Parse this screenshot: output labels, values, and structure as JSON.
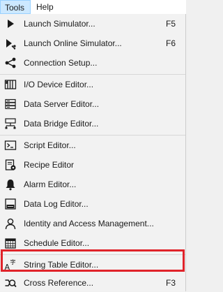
{
  "menubar": {
    "tools": "Tools",
    "help": "Help"
  },
  "menu": {
    "launch_simulator": {
      "label": "Launch Simulator...",
      "shortcut": "F5",
      "icon": "play-icon"
    },
    "launch_online_simulator": {
      "label": "Launch Online Simulator...",
      "shortcut": "F6",
      "icon": "play-network-icon"
    },
    "connection_setup": {
      "label": "Connection Setup...",
      "icon": "share-icon"
    },
    "io_device_editor": {
      "label": "I/O Device Editor...",
      "icon": "io-device-icon"
    },
    "data_server_editor": {
      "label": "Data Server Editor...",
      "icon": "server-icon"
    },
    "data_bridge_editor": {
      "label": "Data Bridge Editor...",
      "icon": "bridge-icon"
    },
    "script_editor": {
      "label": "Script Editor...",
      "icon": "terminal-icon"
    },
    "recipe_editor": {
      "label": "Recipe Editor",
      "icon": "recipe-icon"
    },
    "alarm_editor": {
      "label": "Alarm Editor...",
      "icon": "bell-icon"
    },
    "data_log_editor": {
      "label": "Data Log Editor...",
      "icon": "log-icon"
    },
    "identity_access": {
      "label": "Identity and Access Management...",
      "icon": "person-icon"
    },
    "schedule_editor": {
      "label": "Schedule Editor...",
      "icon": "calendar-icon"
    },
    "string_table_editor": {
      "label": "String Table Editor...",
      "icon": "string-table-icon"
    },
    "cross_reference": {
      "label": "Cross Reference...",
      "shortcut": "F3",
      "icon": "cross-reference-icon"
    }
  },
  "colors": {
    "highlight_border": "#e0232a",
    "menu_bg": "#f2f2f2",
    "active_tab": "#cce8ff"
  }
}
